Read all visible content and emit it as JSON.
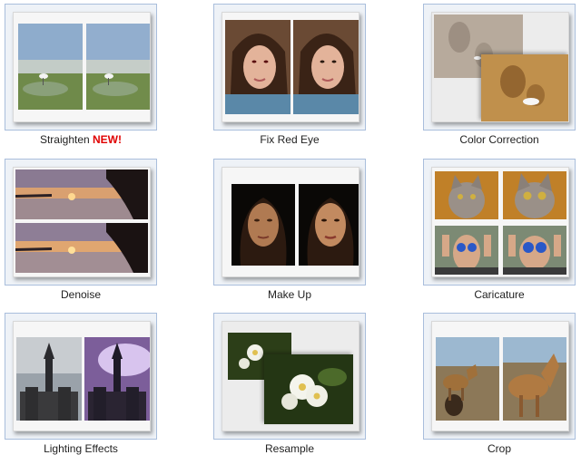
{
  "tools": [
    {
      "label": "Straighten",
      "badge": "NEW!"
    },
    {
      "label": "Fix Red Eye"
    },
    {
      "label": "Color Correction"
    },
    {
      "label": "Denoise"
    },
    {
      "label": "Make Up"
    },
    {
      "label": "Caricature"
    },
    {
      "label": "Lighting Effects"
    },
    {
      "label": "Resample"
    },
    {
      "label": "Crop"
    }
  ],
  "colors": {
    "border": "#a9bedc",
    "badge": "#e00000"
  }
}
